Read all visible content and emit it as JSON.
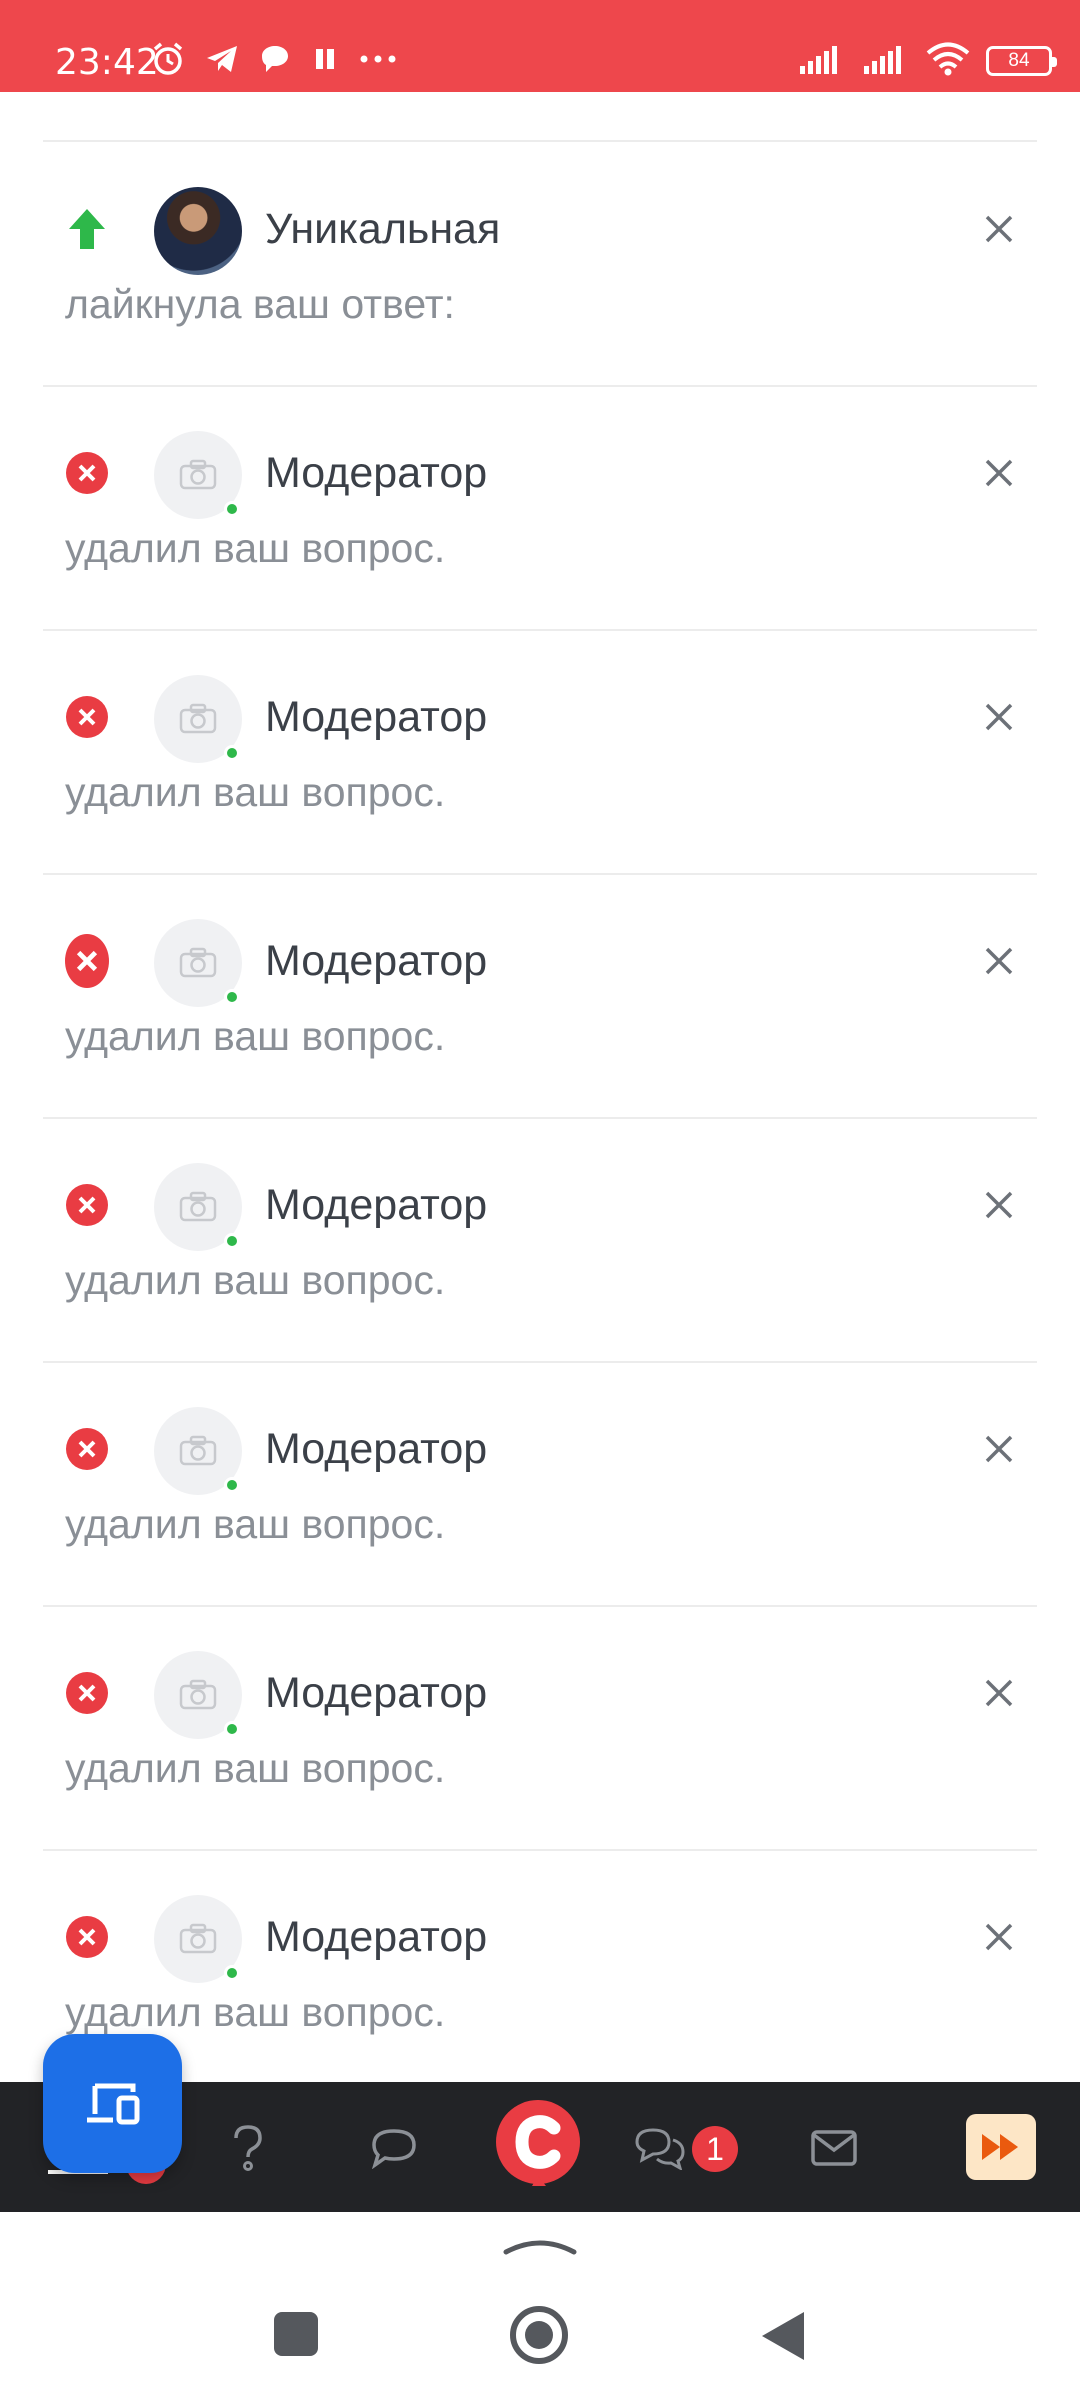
{
  "status_bar": {
    "time": "23:42",
    "battery": "84",
    "left_icons": [
      "alarm-icon",
      "telegram-icon",
      "chat-bubble-icon",
      "pause-icon",
      "more-dots-icon"
    ],
    "right_icons": [
      "signal-icon",
      "signal-icon",
      "wifi-icon",
      "battery-icon"
    ]
  },
  "notifications": [
    {
      "type": "like",
      "name": "Уникальная",
      "text": "лайкнула ваш ответ:",
      "avatar": "photo",
      "online": false
    },
    {
      "type": "deleted",
      "name": "Модератор",
      "text": "удалил ваш вопрос.",
      "avatar": "camera-placeholder",
      "online": true
    },
    {
      "type": "deleted",
      "name": "Модератор",
      "text": "удалил ваш вопрос.",
      "avatar": "camera-placeholder",
      "online": true
    },
    {
      "type": "deleted",
      "name": "Модератор",
      "text": "удалил ваш вопрос.",
      "avatar": "camera-placeholder",
      "online": true
    },
    {
      "type": "deleted",
      "name": "Модератор",
      "text": "удалил ваш вопрос.",
      "avatar": "camera-placeholder",
      "online": true
    },
    {
      "type": "deleted",
      "name": "Модератор",
      "text": "удалил ваш вопрос.",
      "avatar": "camera-placeholder",
      "online": true
    },
    {
      "type": "deleted",
      "name": "Модератор",
      "text": "удалил ваш вопрос.",
      "avatar": "camera-placeholder",
      "online": true
    },
    {
      "type": "deleted",
      "name": "Модератор",
      "text": "удалил ваш вопрос.",
      "avatar": "camera-placeholder",
      "online": true
    }
  ],
  "bottom_bar": {
    "items": [
      "home-icon",
      "question-icon",
      "chat-icon",
      "app-logo",
      "messages-icon",
      "mail-icon",
      "fast-forward-icon"
    ],
    "messages_badge": "1"
  },
  "colors": {
    "status_bar": "#ee474c",
    "accent_blue": "#1d6fe7",
    "delete_red": "#e93c43",
    "like_green": "#2eb84a",
    "app_bar": "#222326"
  }
}
